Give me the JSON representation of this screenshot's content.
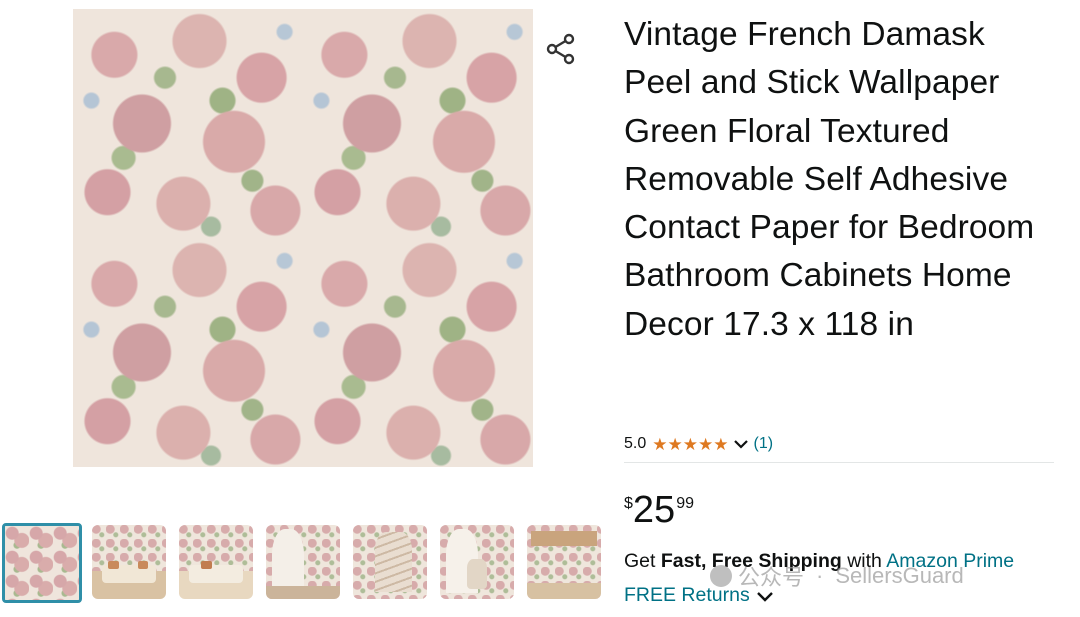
{
  "product": {
    "title": "Vintage French Damask Peel and Stick Wallpaper Green Floral Textured Removable Self Adhesive Contact Paper for Bedroom Bathroom Cabinets Home Decor 17.3 x 118 in",
    "rating": "5.0",
    "stars": 5,
    "review_count": "(1)",
    "price": {
      "symbol": "$",
      "whole": "25",
      "fraction": "99"
    },
    "shipping": {
      "get": "Get",
      "fast_free": "Fast, Free Shipping",
      "with": "with",
      "prime": "Amazon Prime"
    },
    "returns": "FREE Returns"
  },
  "gallery": {
    "share_icon": "share-icon",
    "selected_thumb_color": "#2f8fa8",
    "thumbnails": [
      {
        "kind": "pattern",
        "selected": true
      },
      {
        "kind": "living-room"
      },
      {
        "kind": "sofa-room"
      },
      {
        "kind": "archway"
      },
      {
        "kind": "staircase"
      },
      {
        "kind": "chair-room"
      },
      {
        "kind": "kitchen"
      }
    ]
  },
  "watermark": {
    "cn_text": "公众号",
    "brand": "SellersGuard"
  },
  "colors": {
    "link": "#007185",
    "star": "#de7921",
    "text": "#0f1111"
  }
}
